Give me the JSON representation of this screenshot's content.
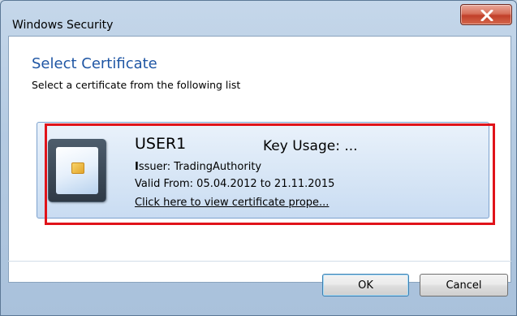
{
  "window": {
    "title": "Windows Security",
    "close_icon": "close-x-icon"
  },
  "dialog": {
    "heading": "Select Certificate",
    "subheading": "Select a certificate from the following list"
  },
  "certificate": {
    "icon": "smart-card-icon",
    "name": "USER1",
    "key_usage": "Key Usage: ...",
    "issuer_label": "I",
    "issuer_rest": "ssuer: TradingAuthority",
    "valid_label": "V",
    "valid_rest": "alid From: 05.04.2012 to 21.11.2015",
    "link_text": "Click here to view certificate prope..."
  },
  "buttons": {
    "ok_label": "OK",
    "cancel_label": "Cancel"
  },
  "colors": {
    "heading": "#1f56a4",
    "highlight": "#e0131a",
    "item_border": "#7da2ce"
  }
}
